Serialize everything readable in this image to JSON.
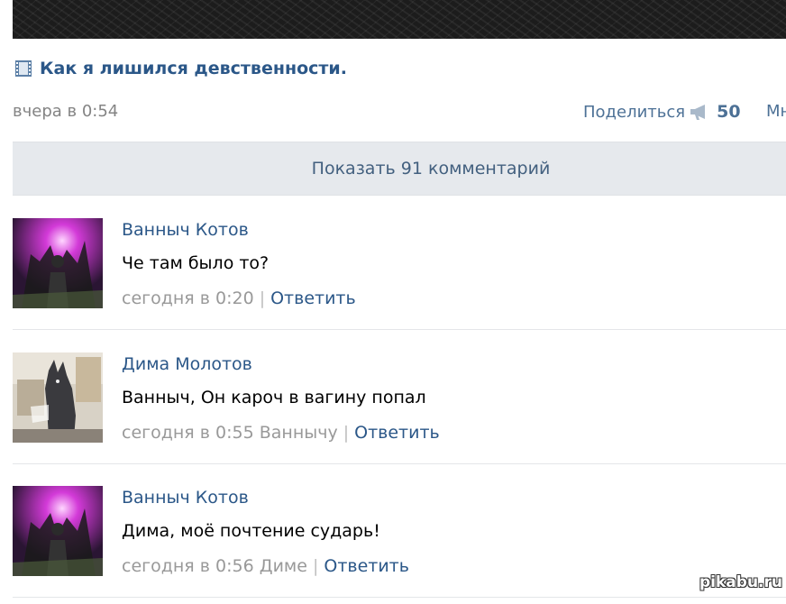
{
  "post": {
    "title": "Как я лишился девственности.",
    "date": "вчера в 0:54",
    "share_label": "Поделиться",
    "share_count": "50",
    "more_label": "Мн"
  },
  "show_comments_label": "Показать 91 комментарий",
  "comments": [
    {
      "author": "Ванныч Котов",
      "text": "Че там было то?",
      "time": "сегодня в 0:20",
      "reply_to": "",
      "reply_label": "Ответить",
      "avatar": "concert-avatar"
    },
    {
      "author": "Дима Молотов",
      "text": "Ванныч, Он кароч в вагину попал",
      "time": "сегодня в 0:55",
      "reply_to": "Ваннычу",
      "reply_label": "Ответить",
      "avatar": "dog-avatar"
    },
    {
      "author": "Ванныч Котов",
      "text": "Дима, моё почтение сударь!",
      "time": "сегодня в 0:56",
      "reply_to": "Диме",
      "reply_label": "Ответить",
      "avatar": "concert-avatar"
    }
  ],
  "icons": {
    "title": "film-icon",
    "share": "megaphone-icon"
  },
  "colors": {
    "link": "#2b5788",
    "meta": "#999999",
    "bar": "#e6e9ed"
  },
  "watermark": "pikabu.ru"
}
